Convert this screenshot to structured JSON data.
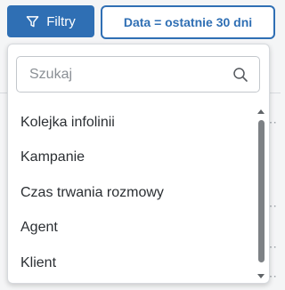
{
  "toolbar": {
    "filters_label": "Filtry",
    "date_filter_label": "Data = ostatnie 30 dni"
  },
  "dropdown": {
    "search": {
      "placeholder": "Szukaj",
      "value": ""
    },
    "items": [
      {
        "label": "Kolejka infolinii"
      },
      {
        "label": "Kampanie"
      },
      {
        "label": "Czas trwania rozmowy"
      },
      {
        "label": "Agent"
      },
      {
        "label": "Klient"
      }
    ]
  },
  "colors": {
    "accent": "#2f6fb4",
    "text": "#2b2f33",
    "placeholder": "#8a8f95"
  },
  "icons": {
    "filters_button": "filter-funnel-icon",
    "search": "search-icon",
    "row_menu": "ellipsis-icon"
  }
}
